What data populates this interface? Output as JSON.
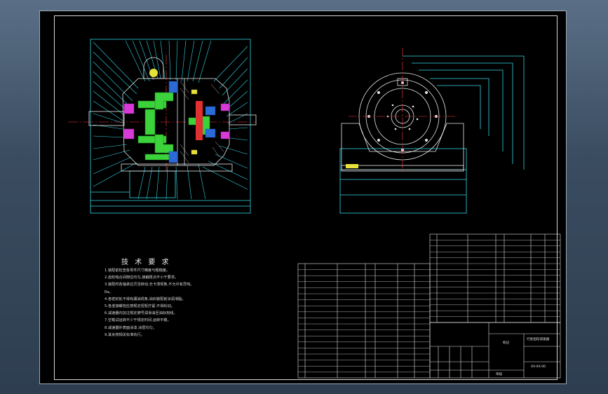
{
  "drawing": {
    "tech_requirements": {
      "title": "技 术 要 求",
      "lines": [
        "1.装配前检查各零件尺寸精度与粗糙度。",
        "2.齿轮啮合间隙应均匀,接触斑点不小于要求。",
        "3.装配时各轴承应灵活转动,无卡滞现象,不允许有异响。",
        "Ra。",
        "4.各密封处不得有漏油现象,油封装配前涂润滑脂。",
        "5.各连接螺栓应按规定扭矩拧紧,不得松动。",
        "6.减速器内加注规定牌号润滑油至油标刻线。",
        "7.空载试运转不少于规定时间,运转平稳。",
        "8.减速器外表面涂漆,涂层均匀。",
        "9.其余按相关标准执行。"
      ]
    },
    "title_block": {
      "name_text": "行星齿轮减速器",
      "sub_text": "XX-XX-00",
      "label_1": "标记",
      "label_2": "审核"
    }
  }
}
